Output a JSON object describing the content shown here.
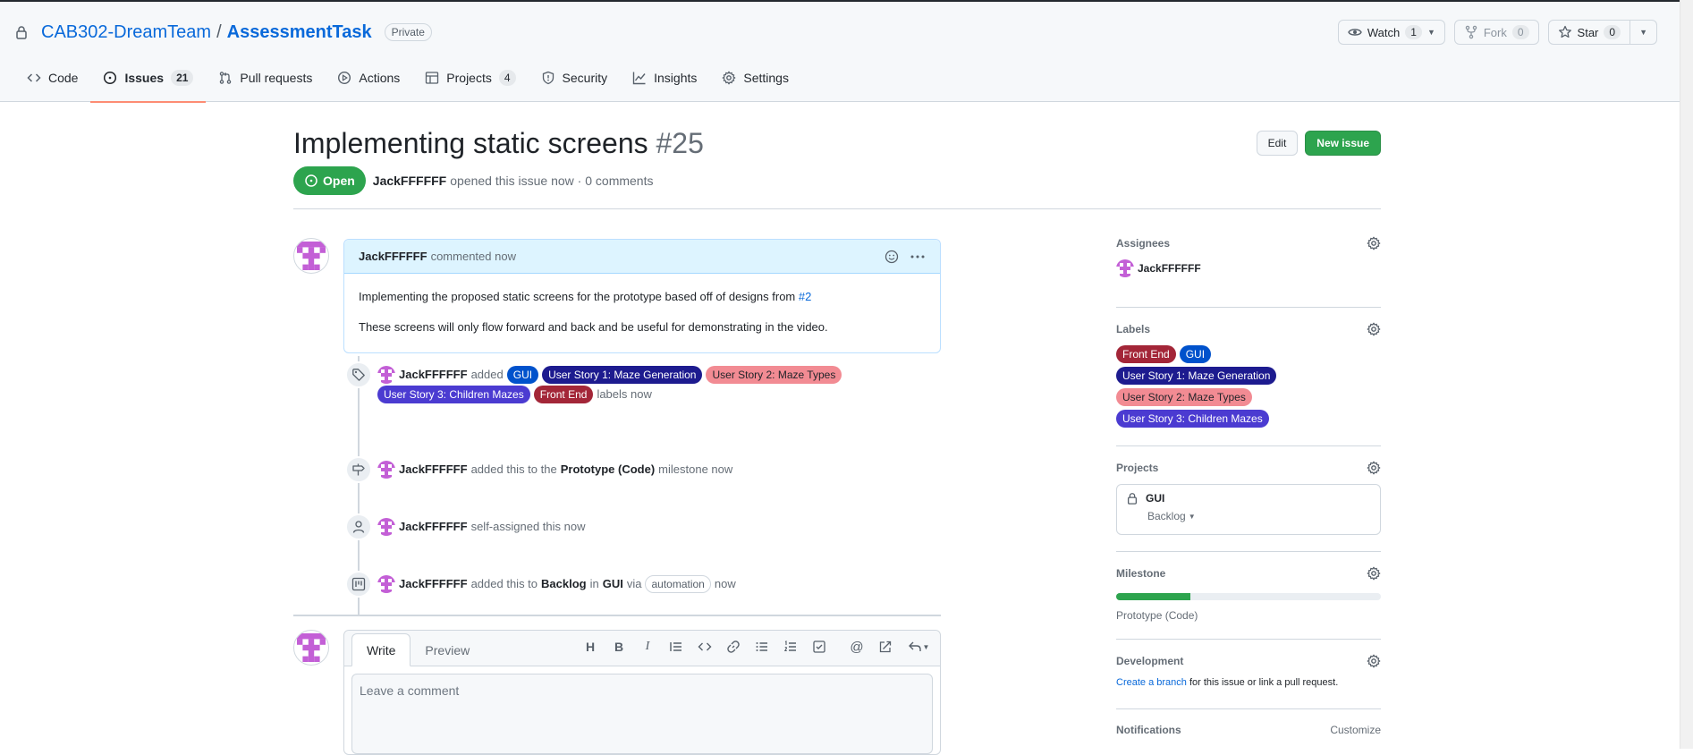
{
  "repo": {
    "owner": "CAB302-DreamTeam",
    "separator": "/",
    "name": "AssessmentTask",
    "visibility": "Private"
  },
  "repo_actions": {
    "watch_label": "Watch",
    "watch_count": "1",
    "fork_label": "Fork",
    "fork_count": "0",
    "star_label": "Star",
    "star_count": "0"
  },
  "nav": {
    "code": "Code",
    "issues": "Issues",
    "issues_count": "21",
    "pulls": "Pull requests",
    "actions": "Actions",
    "projects": "Projects",
    "projects_count": "4",
    "security": "Security",
    "insights": "Insights",
    "settings": "Settings"
  },
  "issue": {
    "title": "Implementing static screens",
    "number": "#25",
    "edit_label": "Edit",
    "new_issue_label": "New issue",
    "state": "Open",
    "author": "JackFFFFFF",
    "meta_text": "opened this issue now · 0 comments"
  },
  "comment": {
    "author": "JackFFFFFF",
    "action": "commented now",
    "body_line1": "Implementing the proposed static screens for the prototype based off of designs from",
    "body_ref": "#2",
    "body_line2": "These screens will only flow forward and back and be useful for demonstrating in the video."
  },
  "events": {
    "labels": {
      "author": "JackFFFFFF",
      "verb": "added",
      "suffix": "labels now",
      "items": [
        "GUI",
        "User Story 1: Maze Generation",
        "User Story 2: Maze Types",
        "User Story 3: Children Mazes",
        "Front End"
      ]
    },
    "milestone": {
      "author": "JackFFFFFF",
      "pre": "added this to the",
      "milestone": "Prototype (Code)",
      "post": "milestone now"
    },
    "assign": {
      "author": "JackFFFFFF",
      "text": "self-assigned this now"
    },
    "project": {
      "author": "JackFFFFFF",
      "pre": "added this to",
      "column": "Backlog",
      "in": "in",
      "project": "GUI",
      "via": "via",
      "automation": "automation",
      "post": "now"
    }
  },
  "composer": {
    "write_tab": "Write",
    "preview_tab": "Preview",
    "placeholder": "Leave a comment"
  },
  "sidebar": {
    "assignees_title": "Assignees",
    "assignee": "JackFFFFFF",
    "labels_title": "Labels",
    "labels": [
      "Front End",
      "GUI",
      "User Story 1: Maze Generation",
      "User Story 2: Maze Types",
      "User Story 3: Children Mazes"
    ],
    "projects_title": "Projects",
    "project_name": "GUI",
    "project_status": "Backlog",
    "milestone_title": "Milestone",
    "milestone_progress": 0.28,
    "milestone_name": "Prototype (Code)",
    "development_title": "Development",
    "dev_link": "Create a branch",
    "dev_text": "for this issue or link a pull request.",
    "notifications_title": "Notifications",
    "customize": "Customize"
  },
  "colors": {
    "GUI": "#0052cc",
    "User Story 1: Maze Generation": "#1d1b8f",
    "User Story 2: Maze Types": "#f28b93",
    "User Story 3: Children Mazes": "#4b3bd1",
    "Front End": "#a32638",
    "open_green": "#2da44e",
    "link_blue": "#0969da"
  }
}
